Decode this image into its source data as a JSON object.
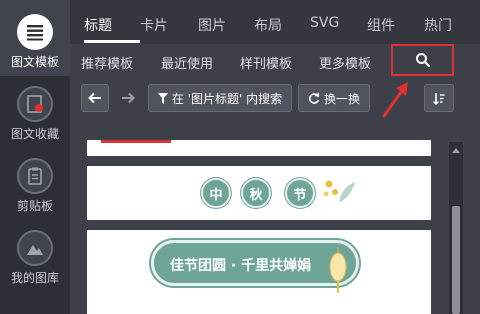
{
  "sidebar": {
    "items": [
      {
        "label": "图文模板",
        "icon": "template-icon"
      },
      {
        "label": "图文收藏",
        "icon": "collection-icon"
      },
      {
        "label": "剪贴板",
        "icon": "clipboard-icon"
      },
      {
        "label": "我的图库",
        "icon": "gallery-icon"
      }
    ]
  },
  "top_tabs": [
    "标题",
    "卡片",
    "图片",
    "布局",
    "SVG",
    "组件",
    "热门"
  ],
  "sub_tabs": [
    "推荐模板",
    "最近使用",
    "样刊模板",
    "更多模板"
  ],
  "toolbar": {
    "filter_label": "在 '图片标题' 内搜索",
    "shuffle_label": "换一换"
  },
  "content": {
    "bubbles": [
      "中",
      "秋",
      "节"
    ],
    "pill_text": "佳节团圆 · 千里共婵娟"
  },
  "colors": {
    "accent_green": "#6fa596",
    "highlight_red": "#e03030"
  }
}
